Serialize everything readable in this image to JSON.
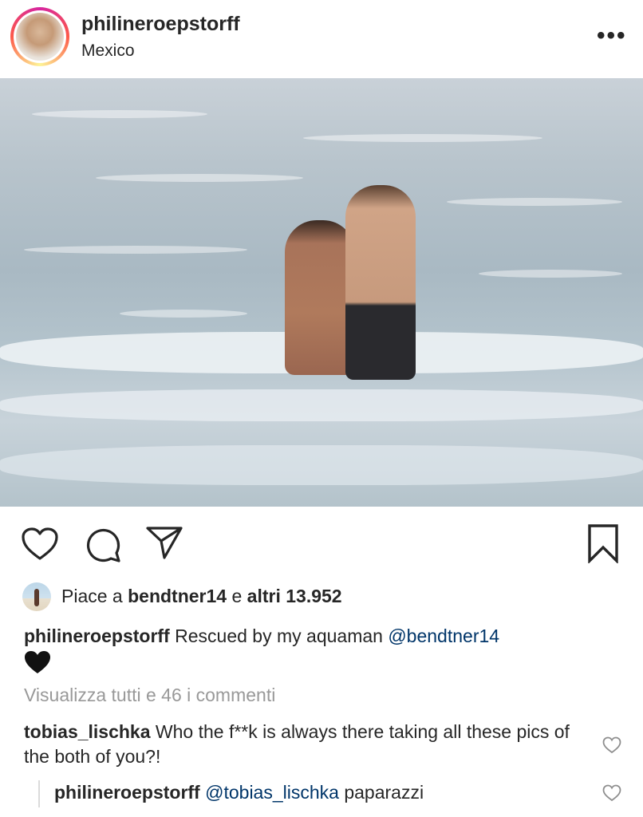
{
  "post": {
    "username": "philineroepstorff",
    "location": "Mexico"
  },
  "likes": {
    "prefix": "Piace a ",
    "user": "bendtner14",
    "middle": " e ",
    "others": "altri 13.952"
  },
  "caption": {
    "username": "philineroepstorff",
    "text": " Rescued by my aquaman ",
    "mention": "@bendtner14",
    "emoji": "black-heart"
  },
  "comments_link": "Visualizza tutti e 46 i commenti",
  "comments": [
    {
      "username": "tobias_lischka",
      "text": " Who the f**k is always there taking all these pics of the both of you?!"
    }
  ],
  "reply": {
    "username": "philineroepstorff",
    "mention": "@tobias_lischka",
    "text": " paparazzi"
  },
  "icons": {
    "more": "more-options-icon",
    "like": "heart-icon",
    "comment": "comment-icon",
    "share": "paper-plane-icon",
    "save": "bookmark-icon",
    "comment_like": "small-heart-icon"
  },
  "colors": {
    "text": "#262626",
    "muted": "#999999",
    "mention": "#003569",
    "divider": "#dbdbdb"
  }
}
